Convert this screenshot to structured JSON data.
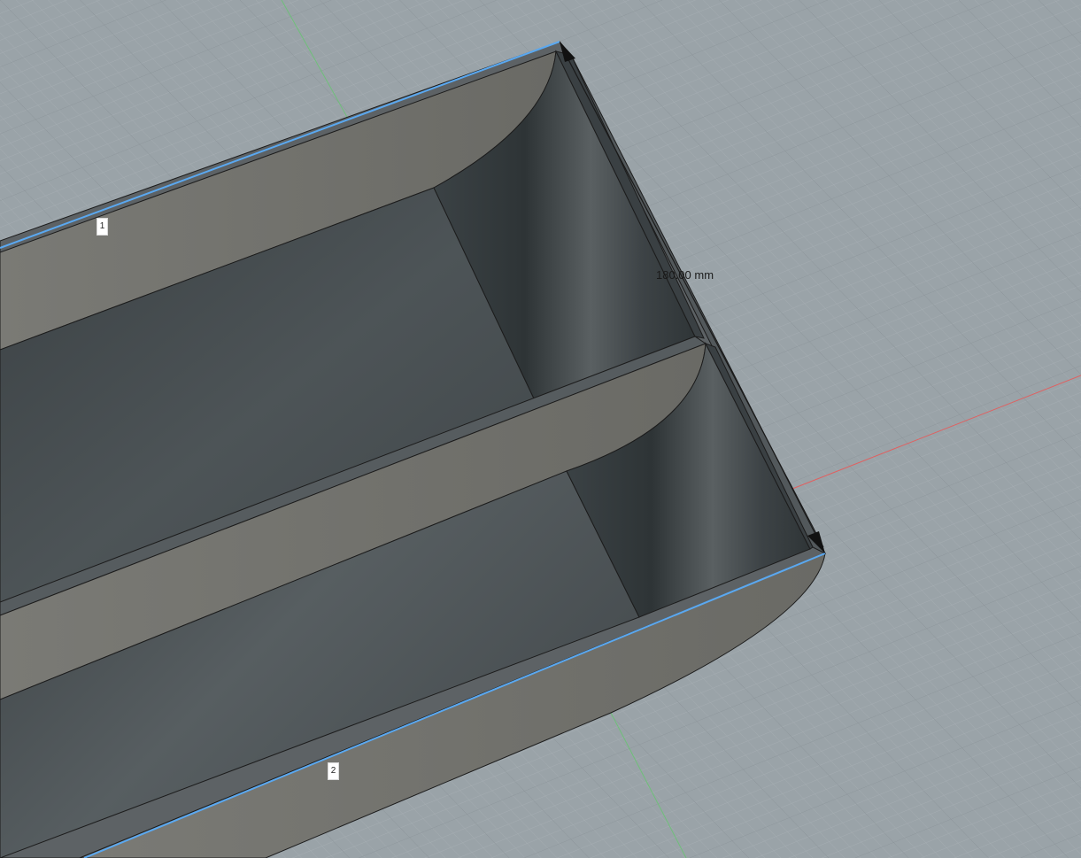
{
  "viewport": {
    "dimension_label": "180.00 mm",
    "edge_tags": [
      {
        "label": "1"
      },
      {
        "label": "2"
      }
    ]
  },
  "colors": {
    "background": "#9aa3a8",
    "grid_minor": "#a3acb1",
    "grid_major": "#8e979c",
    "axis_x": "#e06060",
    "axis_y": "#6fbf7a",
    "selection": "#5aa8f0",
    "body_top": "#6b6b66",
    "wall_face": "#7b7b76",
    "floor": "#4a5154"
  }
}
